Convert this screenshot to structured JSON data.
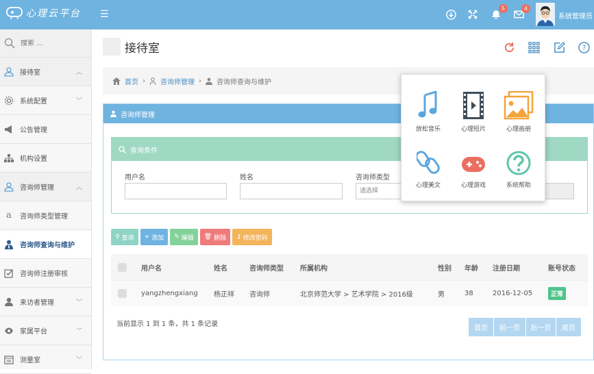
{
  "app": {
    "logo_text": "心理云平台",
    "user_name": "系统管理员"
  },
  "topbar": {
    "notifications_count": "5",
    "messages_count": "4"
  },
  "sidebar": {
    "search_placeholder": "搜索 ...",
    "items": [
      {
        "label": "接待室",
        "icon": "user-icon"
      },
      {
        "label": "系统配置",
        "icon": "gear-icon"
      },
      {
        "label": "公告管理",
        "icon": "bullhorn-icon"
      },
      {
        "label": "机构设置",
        "icon": "sitemap-icon"
      },
      {
        "label": "咨询师管理",
        "icon": "user-icon"
      },
      {
        "label": "咨询师类型管理",
        "icon": "font-icon"
      },
      {
        "label": "咨询师查询与维护",
        "icon": "user-tie-icon"
      },
      {
        "label": "咨询师注册审核",
        "icon": "checkbox-icon"
      },
      {
        "label": "来访者管理",
        "icon": "user-solid-icon"
      },
      {
        "label": "家属平台",
        "icon": "eye-icon"
      },
      {
        "label": "测量室",
        "icon": "calendar-icon"
      }
    ]
  },
  "page": {
    "title": "接待室"
  },
  "breadcrumb": {
    "home": "首页",
    "level1": "咨询师管理",
    "current": "咨询师查询与维护"
  },
  "panel": {
    "title": "咨询师管理"
  },
  "query": {
    "title": "查询条件",
    "username_label": "用户名",
    "name_label": "姓名",
    "type_label": "咨询师类型",
    "type_placeholder": "请选择"
  },
  "buttons": {
    "search": "查询",
    "add": "添加",
    "edit": "编辑",
    "delete": "删除",
    "change_password": "修改密码"
  },
  "table": {
    "headers": [
      "用户名",
      "姓名",
      "咨询师类型",
      "所属机构",
      "性别",
      "年龄",
      "注册日期",
      "账号状态"
    ],
    "rows": [
      [
        "yangzhengxiang",
        "杨正祥",
        "咨询师",
        "北京师范大学 > 艺术学院 > 2016级",
        "男",
        "38",
        "2016-12-05",
        "正常"
      ]
    ]
  },
  "pagination": {
    "info": "当前显示 1 到 1 条，共 1 条记录",
    "first": "首页",
    "prev": "前一页",
    "next": "后一页",
    "last": "尾页"
  },
  "dropdown": {
    "items": [
      {
        "label": "放松音乐",
        "icon": "music-icon"
      },
      {
        "label": "心理短片",
        "icon": "film-icon"
      },
      {
        "label": "心理画册",
        "icon": "images-icon"
      },
      {
        "label": "心理美文",
        "icon": "link-icon"
      },
      {
        "label": "心理游戏",
        "icon": "gamepad-icon"
      },
      {
        "label": "系统帮助",
        "icon": "help-icon"
      }
    ]
  },
  "colors": {
    "topbar": "#6fb3e0",
    "query_header": "#9fd8c3",
    "search_btn": "#8fd3c5",
    "add_btn": "#6fb3e0",
    "edit_btn": "#84d29b",
    "delete_btn": "#ef7b7b",
    "pwd_btn": "#f3b45a",
    "status": "#4fc38b"
  }
}
